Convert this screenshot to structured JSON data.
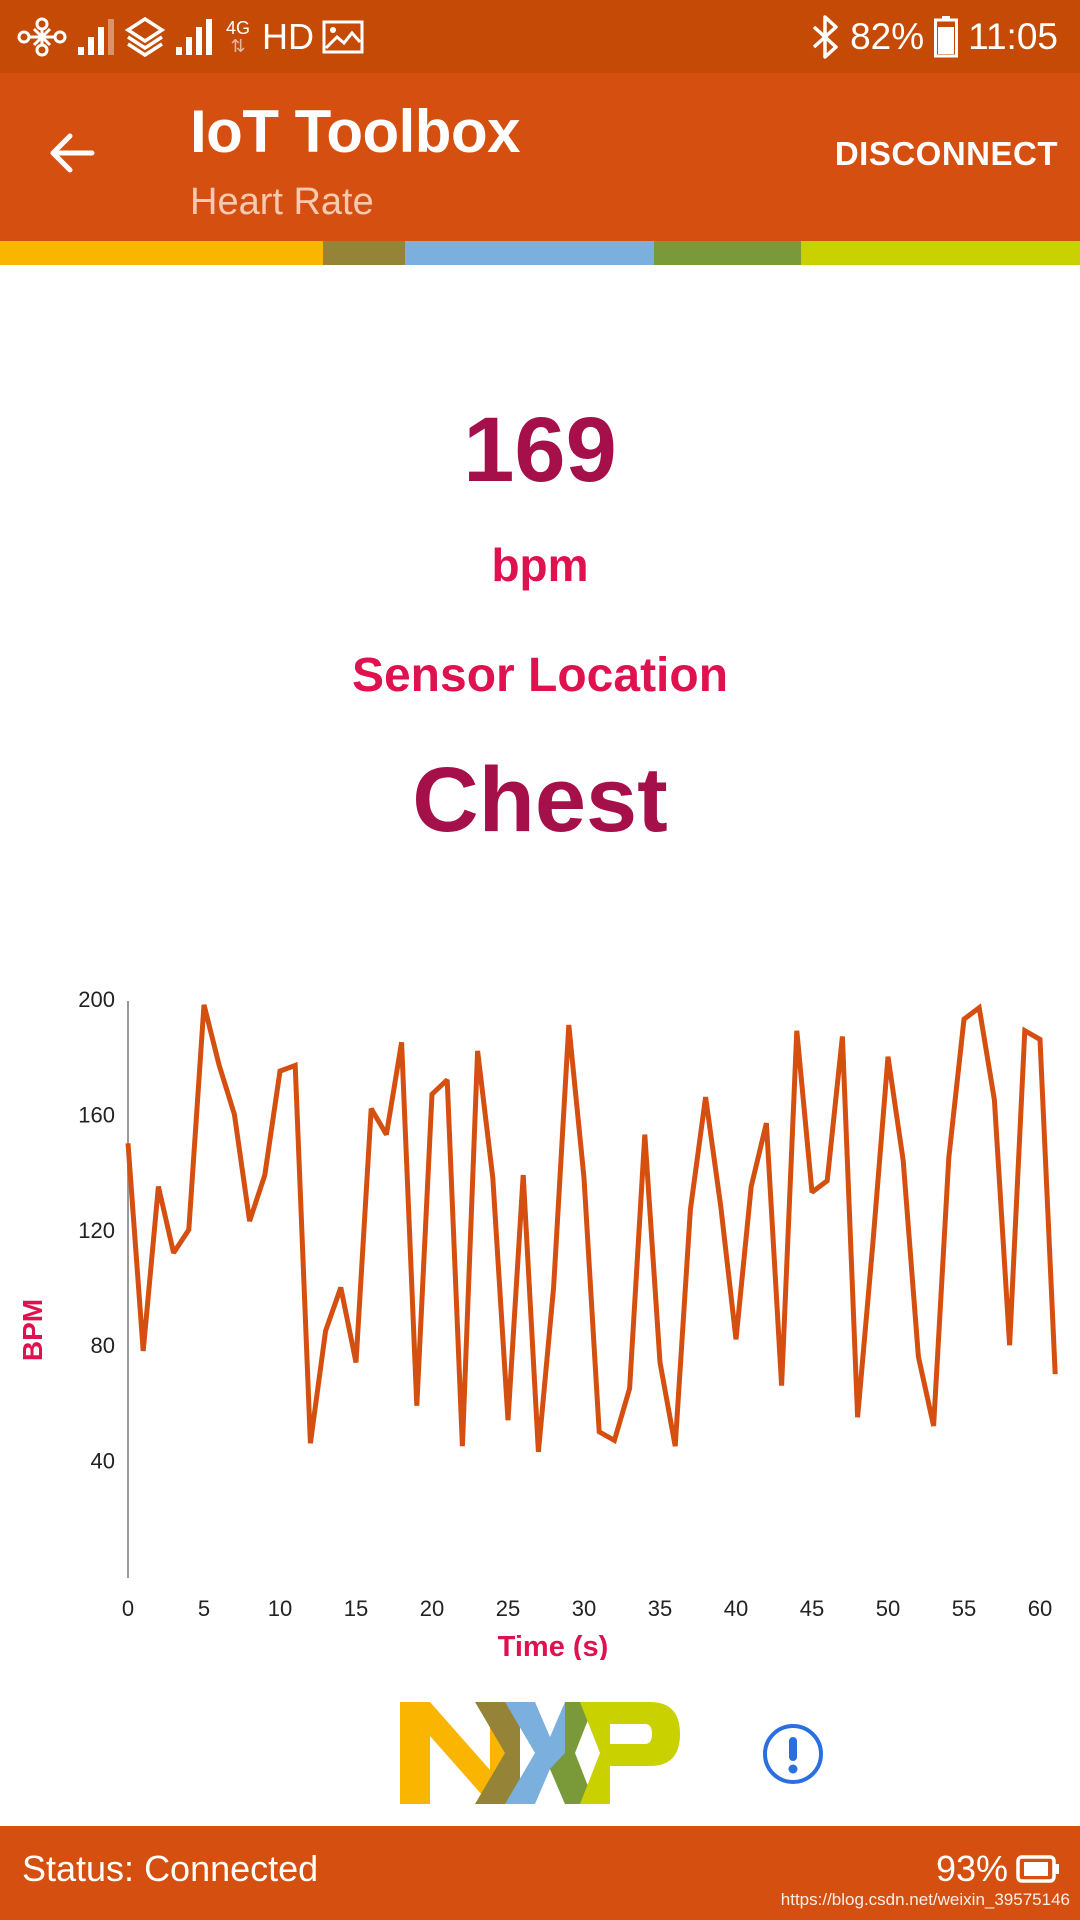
{
  "status_bar": {
    "network_label": "4G",
    "hd_label": "HD",
    "battery_percent": "82%",
    "time": "11:05",
    "icons": [
      "carrier-unicom-icon",
      "signal-icon",
      "carrier-mobile-icon",
      "signal-icon",
      "data-arrows-icon",
      "image-notification-icon",
      "bluetooth-icon",
      "battery-icon"
    ]
  },
  "app_bar": {
    "title": "IoT Toolbox",
    "subtitle": "Heart Rate",
    "action_label": "DISCONNECT",
    "back_icon": "arrow-left-icon"
  },
  "brand_colors": {
    "header": "#D54F11",
    "status_bar": "#C44A05",
    "accent": "#E0114F",
    "value_color": "#A5104B",
    "line_color": "#D54F11",
    "stripe": [
      "#F9B500",
      "#958437",
      "#7BAFDE",
      "#7A9A3A",
      "#C9D200"
    ]
  },
  "readout": {
    "heart_rate": "169",
    "unit": "bpm",
    "location_label": "Sensor Location",
    "location_value": "Chest"
  },
  "chart_data": {
    "type": "line",
    "title": "",
    "xlabel": "Time (s)",
    "ylabel": "BPM",
    "xlim": [
      0,
      61
    ],
    "ylim": [
      0,
      200
    ],
    "x_ticks": [
      0,
      5,
      10,
      15,
      20,
      25,
      30,
      35,
      40,
      45,
      50,
      55,
      60
    ],
    "y_ticks": [
      40,
      80,
      120,
      160,
      200
    ],
    "grid": false,
    "legend": "none",
    "series": [
      {
        "name": "Heart Rate",
        "x": [
          0,
          1,
          2,
          3,
          4,
          5,
          6,
          7,
          8,
          9,
          10,
          11,
          12,
          13,
          14,
          15,
          16,
          17,
          18,
          19,
          20,
          21,
          22,
          23,
          24,
          25,
          26,
          27,
          28,
          29,
          30,
          31,
          32,
          33,
          34,
          35,
          36,
          37,
          38,
          39,
          40,
          41,
          42,
          43,
          44,
          45,
          46,
          47,
          48,
          49,
          50,
          51,
          52,
          53,
          54,
          55,
          56,
          57,
          58,
          59,
          60,
          61
        ],
        "values": [
          150,
          78,
          135,
          112,
          120,
          198,
          177,
          160,
          123,
          139,
          175,
          177,
          46,
          85,
          100,
          74,
          162,
          153,
          185,
          59,
          167,
          172,
          45,
          182,
          138,
          54,
          139,
          43,
          100,
          191,
          138,
          50,
          47,
          65,
          153,
          74,
          45,
          127,
          166,
          128,
          82,
          135,
          157,
          66,
          189,
          133,
          137,
          187,
          55,
          115,
          180,
          144,
          76,
          52,
          145,
          193,
          197,
          165,
          80,
          189,
          186,
          70
        ]
      }
    ]
  },
  "footer": {
    "status": "Status: Connected",
    "battery_percent": "93%",
    "watermark": "https://blog.csdn.net/weixin_39575146"
  }
}
